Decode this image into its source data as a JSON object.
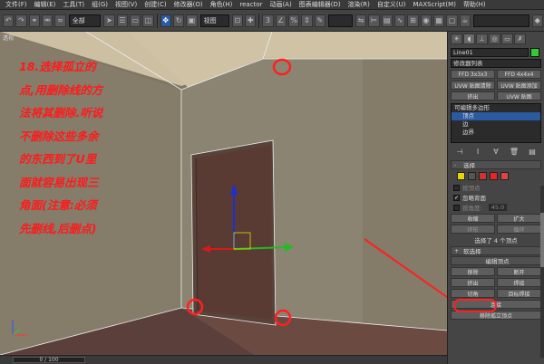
{
  "menu": [
    "文件(F)",
    "编辑(E)",
    "工具(T)",
    "组(G)",
    "视图(V)",
    "创建(C)",
    "修改器(O)",
    "角色(H)",
    "reactor",
    "动画(A)",
    "图表编辑器(D)",
    "渲染(R)",
    "自定义(U)",
    "MAXScript(M)",
    "帮助(H)"
  ],
  "toolbar": {
    "selection_filter": "全部",
    "ref_coord": "视图"
  },
  "annotation": {
    "lines": [
      "18.选择孤立的",
      "点,用删除线的方",
      "法将其删除.听说",
      "不删除这些多余",
      "的东西到了U里",
      "面就容易出现三",
      "角面(注意:必须",
      "先删线,后删点)"
    ]
  },
  "viewport": {
    "label": "透视"
  },
  "status": {
    "timeline": "0 / 100"
  },
  "panel": {
    "object_name": "Line01",
    "modifier_list": "修改器列表",
    "mod_buttons": [
      [
        "FFD 3x3x3",
        "FFD 4x4x4"
      ],
      [
        "UVW 贴图清除",
        "UVW 贴图添加"
      ],
      [
        "挤出",
        "UVW 贴图"
      ]
    ],
    "stack": [
      "可编辑多边形",
      "顶点",
      "边",
      "边界"
    ],
    "selection_title": "选择",
    "by_vertex": "按顶点",
    "ignore_backfacing": "忽略背面",
    "by_angle": "按角度:",
    "angle_value": "45.0",
    "shrink": "收缩",
    "grow": "扩大",
    "ring": "环形",
    "loop": "循环",
    "selected_info": "选择了 4 个顶点",
    "soft_selection": "软选择",
    "edit_vertices": "编辑顶点",
    "remove": "移除",
    "break": "断开",
    "extrude": "挤出",
    "weld": "焊接",
    "chamfer": "切角",
    "target_weld": "目标焊接",
    "connect": "连接",
    "remove_isolated": "移除孤立顶点"
  },
  "colors": {
    "annotation": "#ff1a1a",
    "selection_blue": "#2a5aa0",
    "swatch": "#33cc33"
  }
}
